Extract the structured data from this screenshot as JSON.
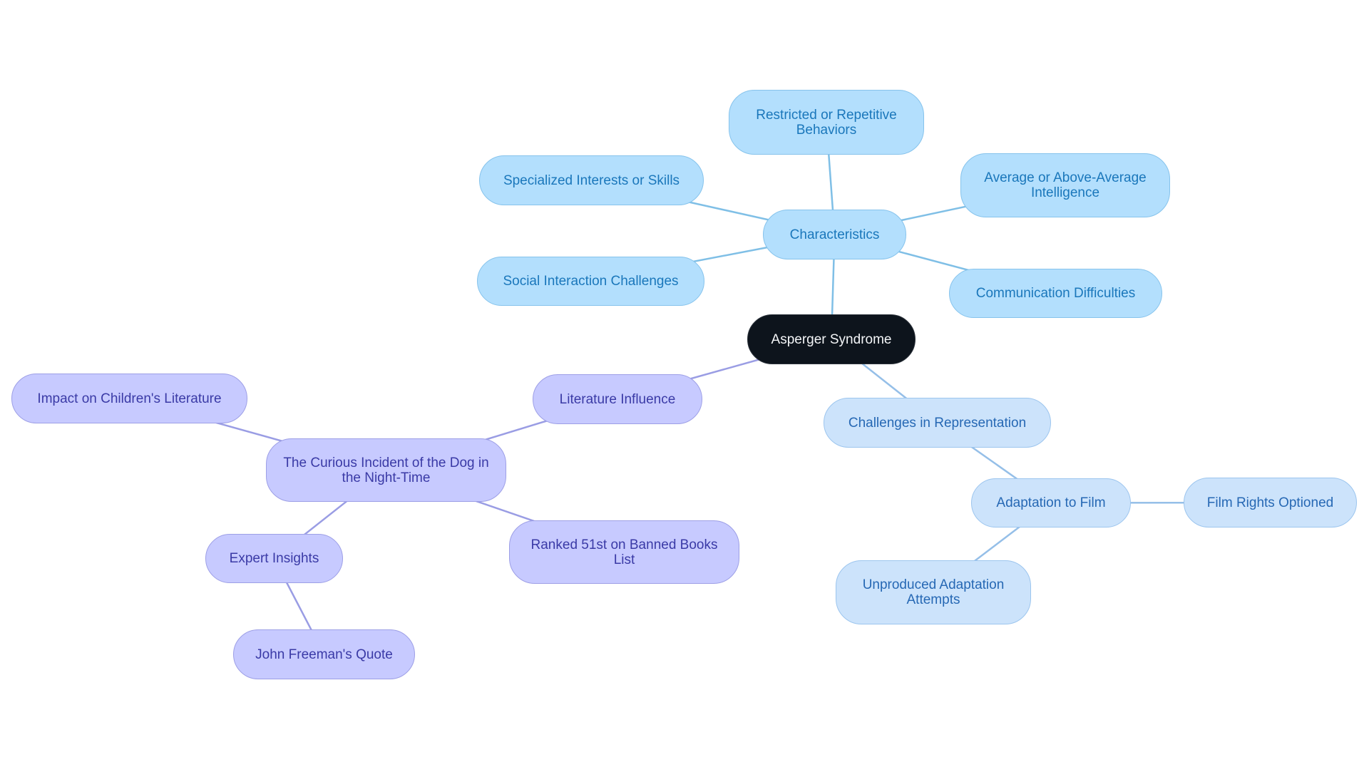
{
  "title": "Asperger Syndrome",
  "colors": {
    "root_fill": "#0d141c",
    "characteristics_fill": "#b3dffd",
    "characteristics_edge": "#7fbfe6",
    "representation_fill": "#cce3fb",
    "representation_edge": "#95bfe8",
    "literature_fill": "#c7caff",
    "literature_edge": "#9a9de4"
  },
  "nodes": {
    "root": "Asperger Syndrome",
    "characteristics": "Characteristics",
    "restricted": "Restricted or Repetitive Behaviors",
    "specialized": "Specialized Interests or Skills",
    "average": "Average or Above-Average Intelligence",
    "social": "Social Interaction Challenges",
    "communication": "Communication Difficulties",
    "literature": "Literature Influence",
    "curious": "The Curious Incident of the Dog in the Night-Time",
    "impact": "Impact on Children's Literature",
    "ranked": "Ranked 51st on Banned Books List",
    "expert": "Expert Insights",
    "john": "John Freeman's Quote",
    "challenges": "Challenges in Representation",
    "adaptation": "Adaptation to Film",
    "film_rights": "Film Rights Optioned",
    "unproduced": "Unproduced Adaptation Attempts"
  },
  "edges": [
    [
      "root",
      "characteristics"
    ],
    [
      "characteristics",
      "restricted"
    ],
    [
      "characteristics",
      "specialized"
    ],
    [
      "characteristics",
      "average"
    ],
    [
      "characteristics",
      "social"
    ],
    [
      "characteristics",
      "communication"
    ],
    [
      "root",
      "literature"
    ],
    [
      "literature",
      "curious"
    ],
    [
      "curious",
      "impact"
    ],
    [
      "curious",
      "ranked"
    ],
    [
      "curious",
      "expert"
    ],
    [
      "expert",
      "john"
    ],
    [
      "root",
      "challenges"
    ],
    [
      "challenges",
      "adaptation"
    ],
    [
      "adaptation",
      "film_rights"
    ],
    [
      "adaptation",
      "unproduced"
    ]
  ]
}
